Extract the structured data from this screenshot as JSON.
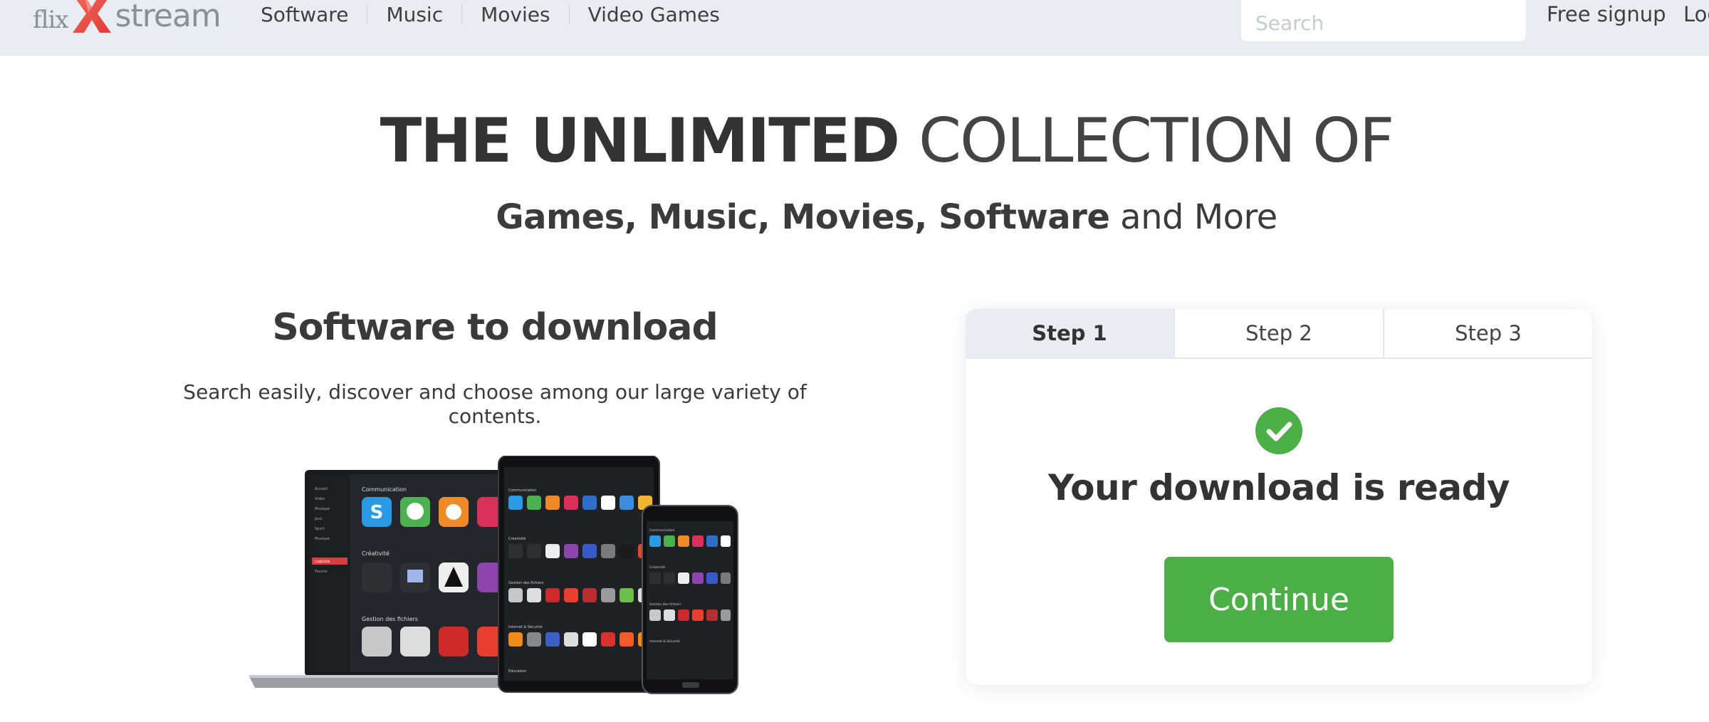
{
  "brand": {
    "part1": "flix",
    "part2": "stream",
    "accent": "#e8443a"
  },
  "nav": {
    "items": [
      "Software",
      "Music",
      "Movies",
      "Video Games"
    ]
  },
  "search": {
    "placeholder": "Search",
    "value": ""
  },
  "account": {
    "signup": "Free signup",
    "login": "Log"
  },
  "hero": {
    "title_bold": "THE UNLIMITED",
    "title_light": "COLLECTION OF",
    "subtitle_bold": "Games, Music, Movies, Software",
    "subtitle_light": "and More"
  },
  "section": {
    "title": "Software to download",
    "description": "Search easily, discover and choose among our large variety of contents."
  },
  "devices": {
    "laptop": {
      "categories": [
        "Communication",
        "Créativité",
        "Gestion des fichiers"
      ],
      "sidebar": [
        "Accueil",
        "Vidéo",
        "Musique",
        "Jeux",
        "Sport",
        "Musique",
        "Logiciels",
        "Favoris"
      ]
    },
    "tablet": {
      "categories": [
        "Communication",
        "Créativité",
        "Gestion des fichiers",
        "Internet & Sécurité",
        "Education"
      ]
    },
    "phone": {
      "categories": [
        "Communication",
        "Créativité",
        "Gestion des fichiers",
        "Internet & Sécurité"
      ]
    }
  },
  "download": {
    "steps": [
      "Step 1",
      "Step 2",
      "Step 3"
    ],
    "active_step": 1,
    "status": "Your download is ready",
    "button": "Continue",
    "accent": "#4cae47"
  }
}
